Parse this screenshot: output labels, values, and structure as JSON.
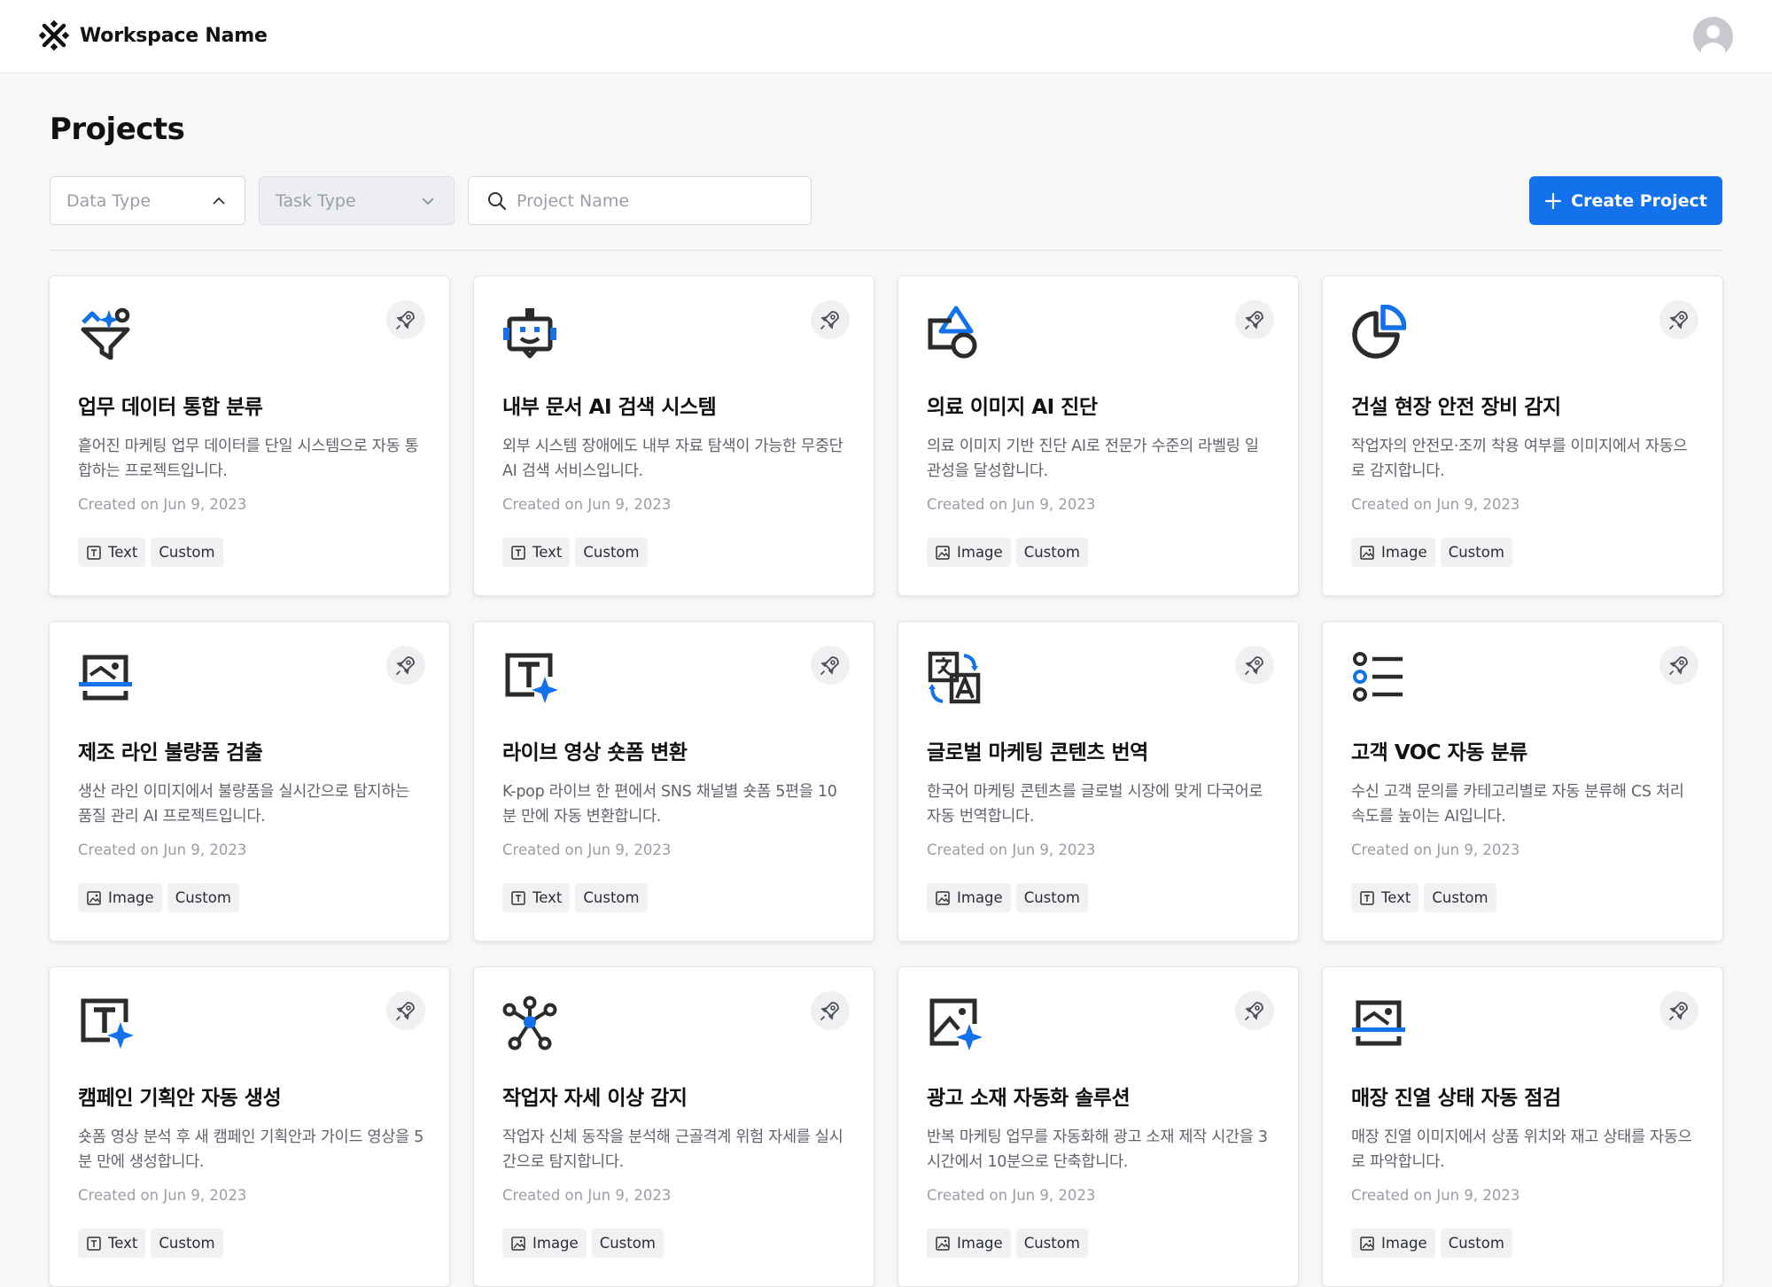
{
  "header": {
    "workspace_name": "Workspace Name"
  },
  "page": {
    "title": "Projects"
  },
  "filters": {
    "data_type_placeholder": "Data Type",
    "task_type_placeholder": "Task Type",
    "search_placeholder": "Project Name",
    "create_label": "Create Project"
  },
  "colors": {
    "accent": "#1471EC",
    "icon_dark": "#2B2B2B"
  },
  "projects": [
    {
      "icon": "funnel-sparkle-icon",
      "title": "업무 데이터 통합 분류",
      "description": "흩어진 마케팅 업무 데이터를 단일 시스템으로 자동 통합하는 프로젝트입니다.",
      "created": "Created on Jun 9, 2023",
      "data_type": "Text",
      "task_type": "Custom"
    },
    {
      "icon": "robot-chat-icon",
      "title": "내부 문서 AI 검색 시스템",
      "description": "외부 시스템 장애에도 내부 자료 탐색이 가능한 무중단 AI 검색 서비스입니다.",
      "created": "Created on Jun 9, 2023",
      "data_type": "Text",
      "task_type": "Custom"
    },
    {
      "icon": "shapes-icon",
      "title": "의료 이미지 AI 진단",
      "description": "의료 이미지 기반 진단 AI로 전문가 수준의 라벨링 일관성을 달성합니다.",
      "created": "Created on Jun 9, 2023",
      "data_type": "Image",
      "task_type": "Custom"
    },
    {
      "icon": "pie-chart-icon",
      "title": "건설 현장 안전 장비 감지",
      "description": "작업자의 안전모·조끼 착용 여부를 이미지에서 자동으로 감지합니다.",
      "created": "Created on Jun 9, 2023",
      "data_type": "Image",
      "task_type": "Custom"
    },
    {
      "icon": "image-scan-icon",
      "title": "제조 라인 불량품 검출",
      "description": "생산 라인 이미지에서 불량품을 실시간으로 탐지하는 품질 관리 AI 프로젝트입니다.",
      "created": "Created on Jun 9, 2023",
      "data_type": "Image",
      "task_type": "Custom"
    },
    {
      "icon": "text-sparkle-icon",
      "title": "라이브 영상 숏폼 변환",
      "description": "K-pop 라이브 한 편에서 SNS 채널별 숏폼 5편을 10분 만에 자동 변환합니다.",
      "created": "Created on Jun 9, 2023",
      "data_type": "Text",
      "task_type": "Custom"
    },
    {
      "icon": "translate-icon",
      "title": "글로벌 마케팅 콘텐츠 번역",
      "description": "한국어 마케팅 콘텐츠를 글로벌 시장에 맞게 다국어로 자동 번역합니다.",
      "created": "Created on Jun 9, 2023",
      "data_type": "Image",
      "task_type": "Custom"
    },
    {
      "icon": "list-classify-icon",
      "title": "고객 VOC 자동 분류",
      "description": "수신 고객 문의를 카테고리별로 자동 분류해 CS 처리 속도를 높이는 AI입니다.",
      "created": "Created on Jun 9, 2023",
      "data_type": "Text",
      "task_type": "Custom"
    },
    {
      "icon": "text-sparkle-icon",
      "title": "캠페인 기획안 자동 생성",
      "description": "숏폼 영상 분석 후 새 캠페인 기획안과 가이드 영상을 5분 만에 생성합니다.",
      "created": "Created on Jun 9, 2023",
      "data_type": "Text",
      "task_type": "Custom"
    },
    {
      "icon": "skeleton-nodes-icon",
      "title": "작업자 자세 이상 감지",
      "description": "작업자 신체 동작을 분석해 근골격계 위험 자세를 실시간으로 탐지합니다.",
      "created": "Created on Jun 9, 2023",
      "data_type": "Image",
      "task_type": "Custom"
    },
    {
      "icon": "image-sparkle-icon",
      "title": "광고 소재 자동화 솔루션",
      "description": "반복 마케팅 업무를 자동화해 광고 소재 제작 시간을 3시간에서 10분으로 단축합니다.",
      "created": "Created on Jun 9, 2023",
      "data_type": "Image",
      "task_type": "Custom"
    },
    {
      "icon": "image-scan-icon",
      "title": "매장 진열 상태 자동 점검",
      "description": "매장 진열 이미지에서 상품 위치와 재고 상태를 자동으로 파악합니다.",
      "created": "Created on Jun 9, 2023",
      "data_type": "Image",
      "task_type": "Custom"
    }
  ]
}
